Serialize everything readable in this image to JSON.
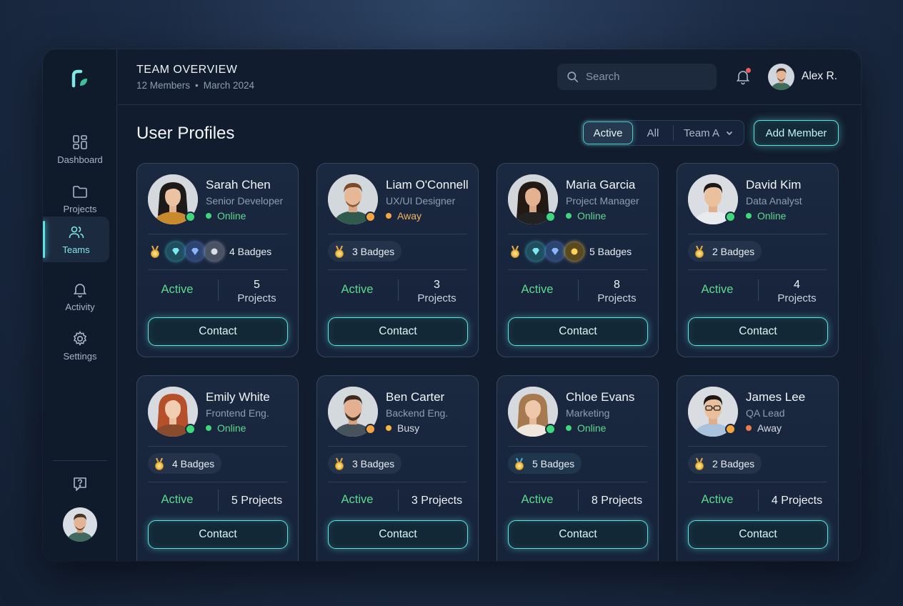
{
  "header": {
    "title": "TEAM OVERVIEW",
    "members": "12 Members",
    "separator": "•",
    "date": "March 2024",
    "search_placeholder": "Search",
    "user_name": "Alex R."
  },
  "sidebar": {
    "items": [
      {
        "label": "Dashboard",
        "icon": "grid-icon"
      },
      {
        "label": "Projects",
        "icon": "folder-icon"
      },
      {
        "label": "Teams",
        "icon": "users-icon",
        "active": true
      },
      {
        "label": "Activity",
        "icon": "bell-icon"
      },
      {
        "label": "Settings",
        "icon": "gear-icon"
      }
    ]
  },
  "main": {
    "title": "User Profiles",
    "filters": {
      "active": "Active",
      "all": "All",
      "team": "Team A"
    },
    "add_button": "Add Member"
  },
  "colors": {
    "accent": "#5fe3e0",
    "online": "#3fd87a",
    "away": "#f5a641",
    "busy": "#f5a641",
    "active_text": "#5fd98d"
  },
  "cards": [
    {
      "name": "Sarah Chen",
      "role": "Senior Developer",
      "status": "Online",
      "badges": "4 Badges",
      "activity": "Active",
      "projects_count": "5",
      "projects_label": "Projects",
      "contact": "Contact"
    },
    {
      "name": "Liam O'Connell",
      "role": "UX/UI Designer",
      "status": "Away",
      "badges": "3 Badges",
      "activity": "Active",
      "projects_count": "3",
      "projects_label": "Projects",
      "contact": "Contact"
    },
    {
      "name": "Maria Garcia",
      "role": "Project Manager",
      "status": "Online",
      "badges": "5 Badges",
      "activity": "Active",
      "projects_count": "8",
      "projects_label": "Projects",
      "contact": "Contact"
    },
    {
      "name": "David Kim",
      "role": "Data Analyst",
      "status": "Online",
      "badges": "2 Badges",
      "activity": "Active",
      "projects_count": "4",
      "projects_label": "Projects",
      "contact": "Contact"
    },
    {
      "name": "Emily White",
      "role": "Frontend Eng.",
      "status": "Online",
      "badges": "4 Badges",
      "activity": "Active",
      "projects": "5 Projects",
      "contact": "Contact"
    },
    {
      "name": "Ben Carter",
      "role": "Backend Eng.",
      "status": "Busy",
      "badges": "3 Badges",
      "activity": "Active",
      "projects": "3 Projects",
      "contact": "Contact"
    },
    {
      "name": "Chloe Evans",
      "role": "Marketing",
      "status": "Online",
      "badges": "5 Badges",
      "activity": "Active",
      "projects": "8 Projects",
      "contact": "Contact"
    },
    {
      "name": "James Lee",
      "role": "QA Lead",
      "status": "Away",
      "badges": "2 Badges",
      "activity": "Active",
      "projects": "4 Projects",
      "contact": "Contact"
    }
  ]
}
